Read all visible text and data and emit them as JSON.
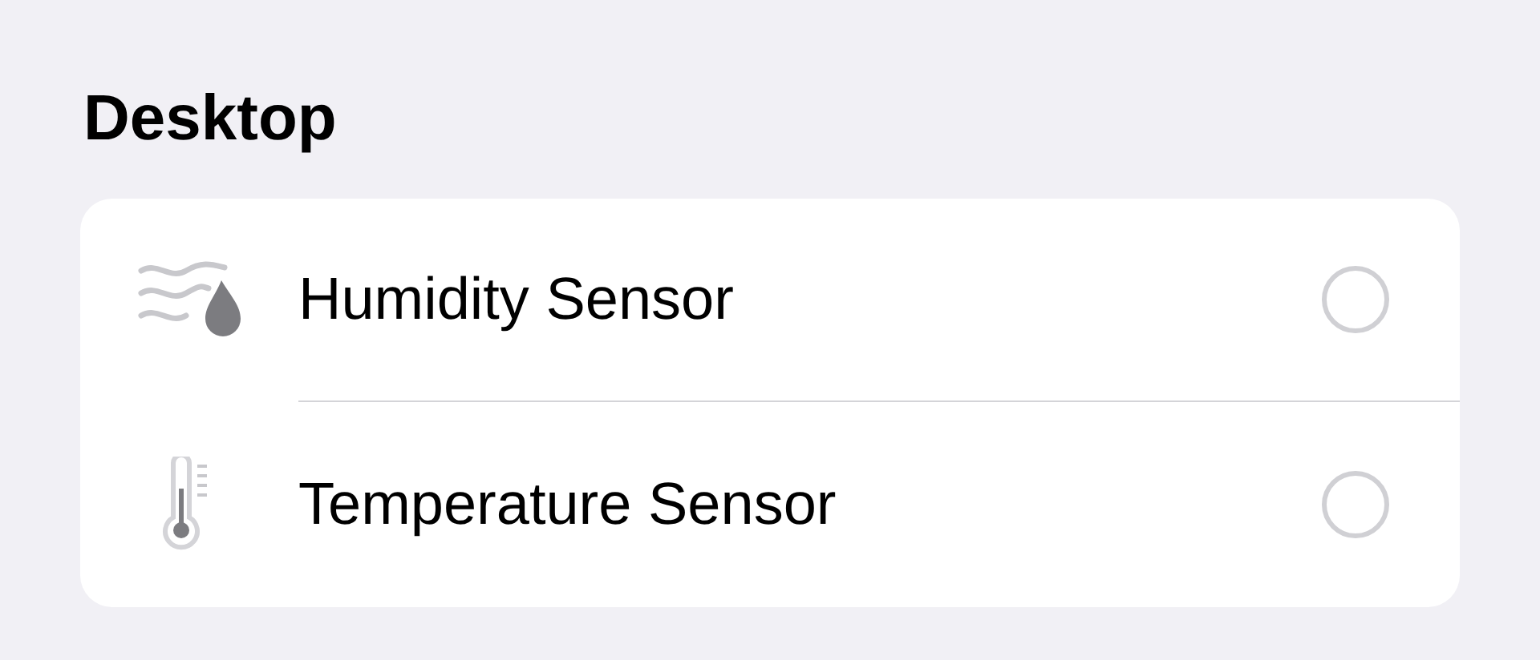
{
  "section": {
    "title": "Desktop"
  },
  "items": [
    {
      "kind": "humidity",
      "label": "Humidity Sensor",
      "selected": false
    },
    {
      "kind": "temperature",
      "label": "Temperature Sensor",
      "selected": false
    }
  ]
}
